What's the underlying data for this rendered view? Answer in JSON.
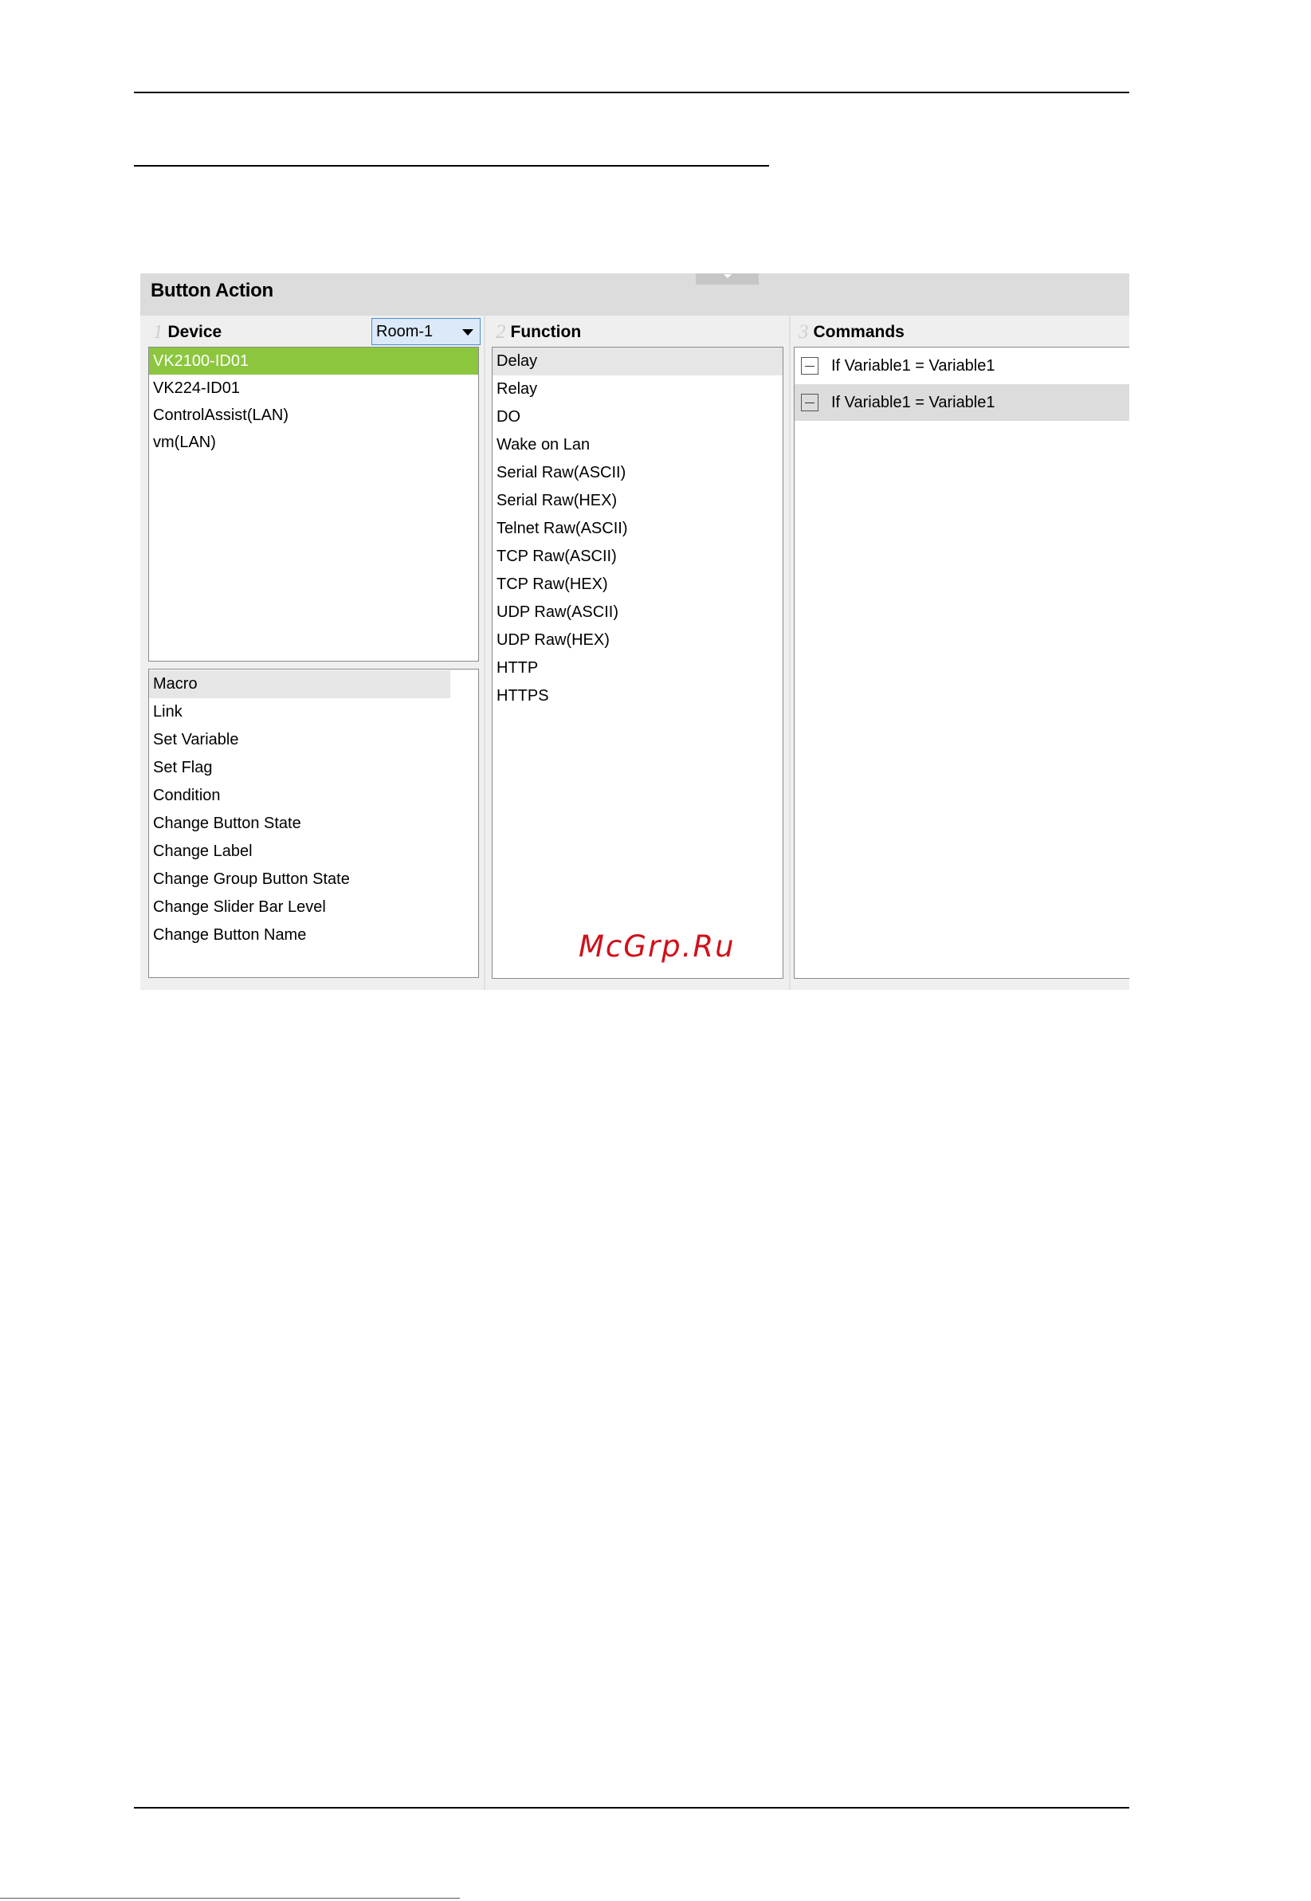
{
  "panel": {
    "title": "Button Action"
  },
  "device": {
    "step": "1",
    "label": "Device",
    "room_select": "Room-1",
    "items": [
      "VK2100-ID01",
      "VK224-ID01",
      "ControlAssist(LAN)",
      "vm(LAN)"
    ],
    "actions": [
      "Macro",
      "Link",
      "Set Variable",
      "Set Flag",
      "Condition",
      "Change Button State",
      "Change Label",
      "Change Group Button State",
      "Change Slider Bar Level",
      "Change Button Name"
    ]
  },
  "function": {
    "step": "2",
    "label": "Function",
    "items": [
      "Delay",
      "Relay",
      "DO",
      "Wake on Lan",
      "Serial Raw(ASCII)",
      "Serial Raw(HEX)",
      "Telnet Raw(ASCII)",
      "TCP Raw(ASCII)",
      "TCP Raw(HEX)",
      "UDP Raw(ASCII)",
      "UDP Raw(HEX)",
      "HTTP",
      "HTTPS"
    ]
  },
  "commands": {
    "step": "3",
    "label": "Commands",
    "items": [
      "If Variable1 = Variable1",
      "If Variable1 = Variable1"
    ]
  },
  "watermark": "McGrp.Ru",
  "colors": {
    "selected_green": "#8cc63f",
    "dropdown_blue": "#dbe9f8",
    "watermark_red": "#d0101a"
  }
}
